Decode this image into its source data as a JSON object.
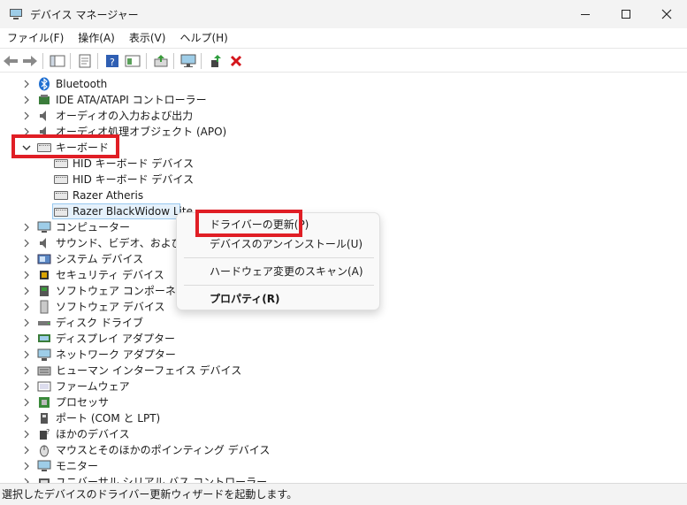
{
  "window": {
    "title": "デバイス マネージャー"
  },
  "menu": [
    "ファイル(F)",
    "操作(A)",
    "表示(V)",
    "ヘルプ(H)"
  ],
  "toolbar": {
    "buttons": [
      "back-icon",
      "forward-icon",
      "show-hide-icon",
      "properties-icon",
      "help-icon",
      "view-icon",
      "update-driver-icon",
      "scan-hardware-icon",
      "enable-device-icon",
      "uninstall-icon"
    ]
  },
  "tree": {
    "categories": [
      "Bluetooth",
      "IDE ATA/ATAPI コントローラー",
      "オーディオの入力および出力",
      "オーディオ処理オブジェクト (APO)",
      "キーボード",
      "コンピューター",
      "サウンド、ビデオ、およびゲーム",
      "システム デバイス",
      "セキュリティ デバイス",
      "ソフトウェア コンポーネント",
      "ソフトウェア デバイス",
      "ディスク ドライブ",
      "ディスプレイ アダプター",
      "ネットワーク アダプター",
      "ヒューマン インターフェイス デバイス",
      "ファームウェア",
      "プロセッサ",
      "ポート (COM と LPT)",
      "ほかのデバイス",
      "マウスとそのほかのポインティング デバイス",
      "モニター",
      "ユニバーサル シリアル バス コントローラー"
    ],
    "keyboard_children": [
      "HID キーボード デバイス",
      "HID キーボード デバイス",
      "Razer Atheris",
      "Razer BlackWidow Lite"
    ]
  },
  "context_menu": {
    "items": [
      "ドライバーの更新(P)",
      "デバイスのアンインストール(U)",
      "ハードウェア変更のスキャン(A)",
      "プロパティ(R)"
    ]
  },
  "status": {
    "text": "選択したデバイスのドライバー更新ウィザードを起動します。"
  },
  "colors": {
    "highlight_red": "#e01e25",
    "selection_bg": "#e5f1fb"
  }
}
